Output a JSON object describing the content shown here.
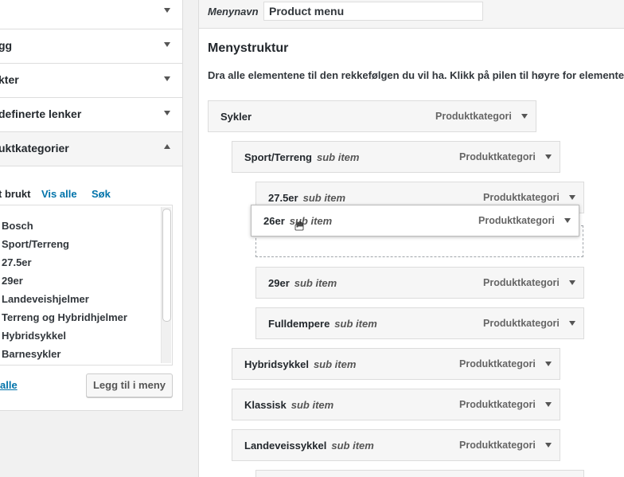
{
  "left": {
    "accordion": [
      {
        "label": ""
      },
      {
        "label": "gg"
      },
      {
        "label": "kter"
      },
      {
        "label": "definerte lenker"
      },
      {
        "label": "uktkategorier"
      }
    ],
    "tabs": {
      "recent": "t brukt",
      "all": "Vis alle",
      "search": "Søk"
    },
    "items": [
      "Bosch",
      "Sport/Terreng",
      "27.5er",
      "29er",
      "Landeveishjelmer",
      "Terreng og Hybridhjelmer",
      "Hybridsykkel",
      "Barnesykler"
    ],
    "select_all": "alle",
    "add_button": "Legg til i meny"
  },
  "right": {
    "menu_name_label": "Menynavn",
    "menu_name_value": "Product menu",
    "heading": "Menystruktur",
    "instructions": "Dra alle elementene til den rekkefølgen du vil ha. Klikk på pilen til høyre for elementet for å",
    "items": [
      {
        "title": "Sykler",
        "sub": "",
        "type": "Produktkategori"
      },
      {
        "title": "Sport/Terreng",
        "sub": "sub item",
        "type": "Produktkategori"
      },
      {
        "title": "27.5er",
        "sub": "sub item",
        "type": "Produktkategori"
      },
      {
        "title": "26er",
        "sub": "sub item",
        "type": "Produktkategori"
      },
      {
        "title": "29er",
        "sub": "sub item",
        "type": "Produktkategori"
      },
      {
        "title": "Fulldempere",
        "sub": "sub item",
        "type": "Produktkategori"
      },
      {
        "title": "Hybridsykkel",
        "sub": "sub item",
        "type": "Produktkategori"
      },
      {
        "title": "Klassisk",
        "sub": "sub item",
        "type": "Produktkategori"
      },
      {
        "title": "Landeveissykkel",
        "sub": "sub item",
        "type": "Produktkategori"
      }
    ]
  }
}
